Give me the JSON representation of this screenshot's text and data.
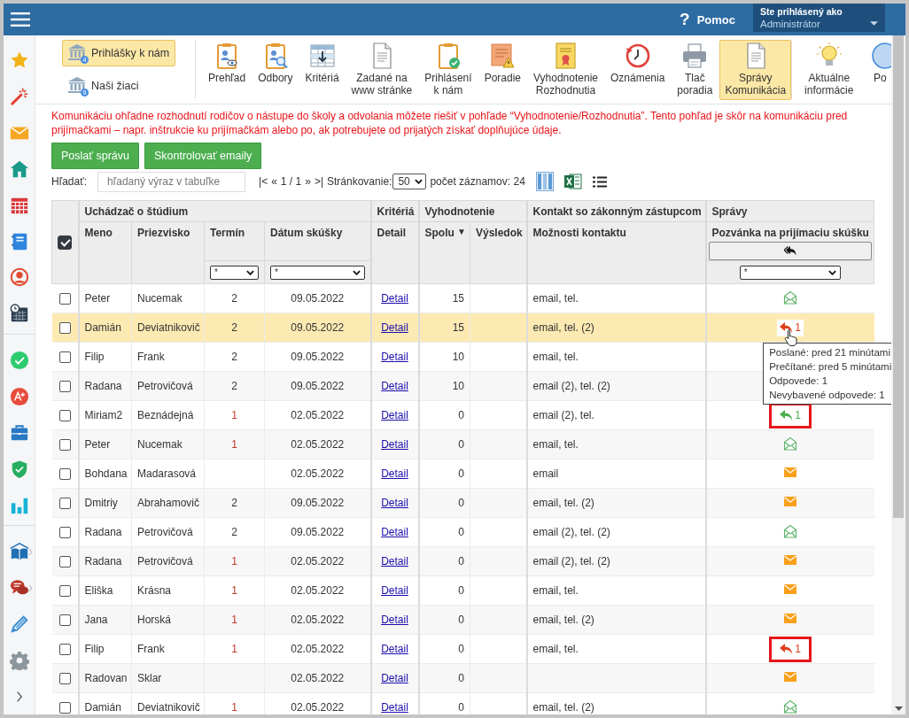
{
  "topbar": {
    "help_mark": "?",
    "help_label": "Pomoc",
    "user_caption": "Ste prihlásený ako",
    "user_name": "Administrátor"
  },
  "toolbar": {
    "side_buttons": [
      {
        "label": "Prihlášky k nám",
        "badge": "4",
        "selected": true
      },
      {
        "label": "Naši žiaci",
        "badge": "9",
        "selected": false
      }
    ],
    "tool_groups": [
      [
        {
          "lines": [
            "Prehľad"
          ],
          "selected": false
        },
        {
          "lines": [
            "Odbory"
          ],
          "selected": false
        },
        {
          "lines": [
            "Kritériá"
          ],
          "selected": false
        },
        {
          "lines": [
            "Zadané na",
            "www stránke"
          ],
          "selected": false
        },
        {
          "lines": [
            "Prihlásení",
            "k nám"
          ],
          "selected": false
        },
        {
          "lines": [
            "Poradie"
          ],
          "selected": false
        },
        {
          "lines": [
            "Vyhodnotenie",
            "Rozhodnutia"
          ],
          "selected": false
        },
        {
          "lines": [
            "Oznámenia"
          ],
          "selected": false
        },
        {
          "lines": [
            "Tlač",
            "poradia"
          ],
          "selected": false
        },
        {
          "lines": [
            "Správy",
            "Komunikácia"
          ],
          "selected": true
        }
      ],
      [
        {
          "lines": [
            "Aktuálne",
            "informácie"
          ],
          "selected": false
        },
        {
          "lines": [
            "Po"
          ],
          "selected": false
        }
      ]
    ]
  },
  "notice": "Komunikáciu ohľadne rozhodnutí rodičov o nástupe do školy a odvolania môžete riešiť v pohľade “Vyhodnotenie/Rozhodnutia”. Tento pohľad je skôr na komunikáciu pred prijímačkami – napr. inštrukcie ku prijímačkám alebo po, ak potrebujete od prijatých získať doplňujúce údaje.",
  "actions": [
    "Poslať správu",
    "Skontrolovať emaily"
  ],
  "search": {
    "label": "Hľadať:",
    "placeholder": "hľadaný výraz v tabuľke"
  },
  "pager": {
    "first": "|<",
    "prev": "«",
    "page": "1 / 1",
    "next": "»",
    "last": ">|",
    "page_size_label": "Stránkovanie:",
    "page_size": "50",
    "count": "počet záznamov: 24"
  },
  "table": {
    "select_all_checked": true,
    "groups": [
      "Uchádzač o štúdium",
      "Kritériá",
      "Vyhodnotenie",
      "Kontakt so zákonným zástupcom",
      "Správy"
    ],
    "columns": [
      {
        "label": "Meno"
      },
      {
        "label": "Priezvisko"
      },
      {
        "label": "Termín",
        "filter": "*"
      },
      {
        "label": "Dátum skúšky",
        "filter": "*"
      },
      {
        "label": "Detail"
      },
      {
        "label": "Spolu",
        "sort_mark": "▼"
      },
      {
        "label": "Výsledok"
      },
      {
        "label": "Možnosti kontaktu"
      },
      {
        "label": "Pozvánka na prijímaciu skúšku",
        "filter": "*"
      }
    ],
    "rows": [
      {
        "checked": false,
        "selected": false,
        "first_name": "Peter",
        "last_name": "Nucemak",
        "term": {
          "value": "2",
          "color": "#333333"
        },
        "exam_date": "09.05.2022",
        "detail": "Detail",
        "total": "15",
        "contact": "email, tel.",
        "message": {
          "kind": "opened"
        }
      },
      {
        "checked": false,
        "selected": true,
        "first_name": "Damián",
        "last_name": "Deviatnikovič",
        "term": {
          "value": "2",
          "color": "#333333"
        },
        "exam_date": "09.05.2022",
        "detail": "Detail",
        "total": "15",
        "contact": "email, tel. (2)",
        "message": {
          "kind": "reply",
          "count": "1",
          "color": "#e0401c",
          "marked": false,
          "tooltip": [
            "Poslané: pred 21 minútami",
            "Prečítané: pred 5 minútami",
            "Odpovede: 1",
            "Nevybavené odpovede: 1"
          ]
        }
      },
      {
        "checked": false,
        "selected": false,
        "first_name": "Filip",
        "last_name": "Frank",
        "term": {
          "value": "2",
          "color": "#333333"
        },
        "exam_date": "09.05.2022",
        "detail": "Detail",
        "total": "10",
        "contact": "email, tel."
      },
      {
        "checked": false,
        "selected": false,
        "first_name": "Radana",
        "last_name": "Petrovičová",
        "term": {
          "value": "2",
          "color": "#333333"
        },
        "exam_date": "09.05.2022",
        "detail": "Detail",
        "total": "10",
        "contact": "email (2), tel. (2)"
      },
      {
        "checked": false,
        "selected": false,
        "first_name": "Miriam2",
        "last_name": "Beznádejná",
        "term": {
          "value": "1",
          "color": "#c0392b"
        },
        "exam_date": "02.05.2022",
        "detail": "Detail",
        "total": "0",
        "contact": "email (2), tel.",
        "message": {
          "kind": "reply",
          "count": "1",
          "color": "#4caf50",
          "marked": true
        }
      },
      {
        "checked": false,
        "selected": false,
        "first_name": "Peter",
        "last_name": "Nucemak",
        "term": {
          "value": "1",
          "color": "#c0392b"
        },
        "exam_date": "02.05.2022",
        "detail": "Detail",
        "total": "0",
        "contact": "email, tel.",
        "message": {
          "kind": "opened"
        }
      },
      {
        "checked": false,
        "selected": false,
        "first_name": "Bohdana",
        "last_name": "Madarasová",
        "exam_date": "02.05.2022",
        "detail": "Detail",
        "total": "0",
        "contact": "email",
        "message": {
          "kind": "unread"
        }
      },
      {
        "checked": false,
        "selected": false,
        "first_name": "Dmitriy",
        "last_name": "Abrahamovič",
        "term": {
          "value": "2",
          "color": "#333333"
        },
        "exam_date": "09.05.2022",
        "detail": "Detail",
        "total": "0",
        "contact": "email, tel. (2)",
        "message": {
          "kind": "unread"
        }
      },
      {
        "checked": false,
        "selected": false,
        "first_name": "Radana",
        "last_name": "Petrovičová",
        "term": {
          "value": "2",
          "color": "#333333"
        },
        "exam_date": "09.05.2022",
        "detail": "Detail",
        "total": "0",
        "contact": "email (2), tel. (2)",
        "message": {
          "kind": "opened"
        }
      },
      {
        "checked": false,
        "selected": false,
        "first_name": "Radana",
        "last_name": "Petrovičová",
        "term": {
          "value": "1",
          "color": "#c0392b"
        },
        "exam_date": "02.05.2022",
        "detail": "Detail",
        "total": "0",
        "contact": "email (2), tel. (2)",
        "message": {
          "kind": "unread"
        }
      },
      {
        "checked": false,
        "selected": false,
        "first_name": "Eliška",
        "last_name": "Krásna",
        "term": {
          "value": "1",
          "color": "#c0392b"
        },
        "exam_date": "02.05.2022",
        "detail": "Detail",
        "total": "0",
        "contact": "email, tel.",
        "message": {
          "kind": "unread"
        }
      },
      {
        "checked": false,
        "selected": false,
        "first_name": "Jana",
        "last_name": "Horská",
        "term": {
          "value": "1",
          "color": "#c0392b"
        },
        "exam_date": "02.05.2022",
        "detail": "Detail",
        "total": "0",
        "contact": "email, tel. (2)",
        "message": {
          "kind": "unread"
        }
      },
      {
        "checked": false,
        "selected": false,
        "first_name": "Filip",
        "last_name": "Frank",
        "term": {
          "value": "1",
          "color": "#c0392b"
        },
        "exam_date": "02.05.2022",
        "detail": "Detail",
        "total": "0",
        "contact": "email, tel.",
        "message": {
          "kind": "reply",
          "count": "1",
          "color": "#e0401c",
          "marked": true
        }
      },
      {
        "checked": false,
        "selected": false,
        "first_name": "Radovan",
        "last_name": "Sklar",
        "exam_date": "02.05.2022",
        "detail": "Detail",
        "total": "0",
        "message": {
          "kind": "unread"
        }
      },
      {
        "checked": false,
        "selected": false,
        "first_name": "Damián",
        "last_name": "Deviatnikovič",
        "term": {
          "value": "1",
          "color": "#c0392b"
        },
        "exam_date": "02.05.2022",
        "detail": "Detail",
        "total": "0",
        "contact": "email, tel. (2)",
        "message": {
          "kind": "opened"
        }
      }
    ]
  }
}
